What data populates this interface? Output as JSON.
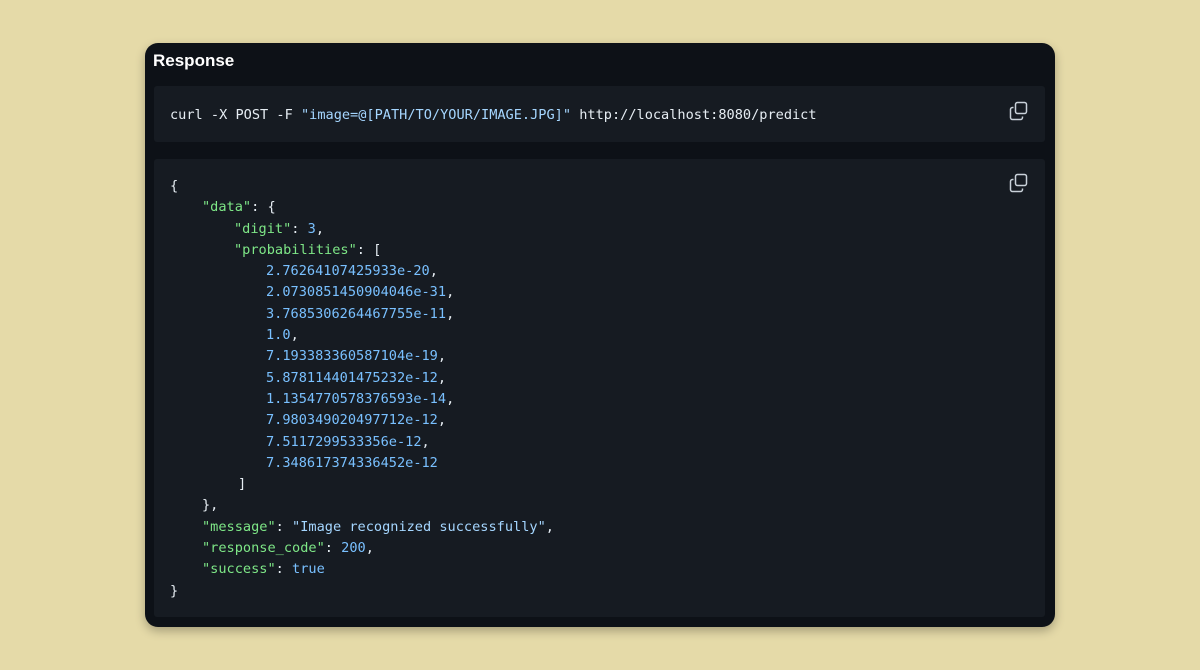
{
  "panel": {
    "title": "Response"
  },
  "command": {
    "prefix": "curl -X POST -F ",
    "form_value": "\"image=@[PATH/TO/YOUR/IMAGE.JPG]\"",
    "suffix": " http://localhost:8080/predict",
    "copy_icon": "copy-icon"
  },
  "json": {
    "copy_icon": "copy-icon",
    "open_brace": "{",
    "data_key": "\"data\"",
    "data_open": ": {",
    "digit_key": "\"digit\"",
    "digit_sep": ": ",
    "digit_value": "3",
    "digit_comma": ",",
    "probabilities_key": "\"probabilities\"",
    "probabilities_open": ": [",
    "probabilities": [
      "2.76264107425933e-20",
      "2.0730851450904046e-31",
      "3.7685306264467755e-11",
      "1.0",
      "7.193383360587104e-19",
      "5.878114401475232e-12",
      "1.1354770578376593e-14",
      "7.980349020497712e-12",
      "7.5117299533356e-12",
      "7.348617374336452e-12"
    ],
    "comma": ",",
    "array_close": "]",
    "data_close": "},",
    "message_key": "\"message\"",
    "message_sep": ": ",
    "message_value": "\"Image recognized successfully\"",
    "message_comma": ",",
    "response_code_key": "\"response_code\"",
    "response_code_sep": ": ",
    "response_code_value": "200",
    "response_code_comma": ",",
    "success_key": "\"success\"",
    "success_sep": ": ",
    "success_value": "true",
    "close_brace": "}"
  },
  "colors": {
    "page_background": "#e5daa8",
    "panel_background": "#0d1117",
    "code_background": "#161b22",
    "string": "#a5d6ff",
    "key": "#7ee787",
    "number": "#79c0ff",
    "text": "#e6edf3"
  }
}
